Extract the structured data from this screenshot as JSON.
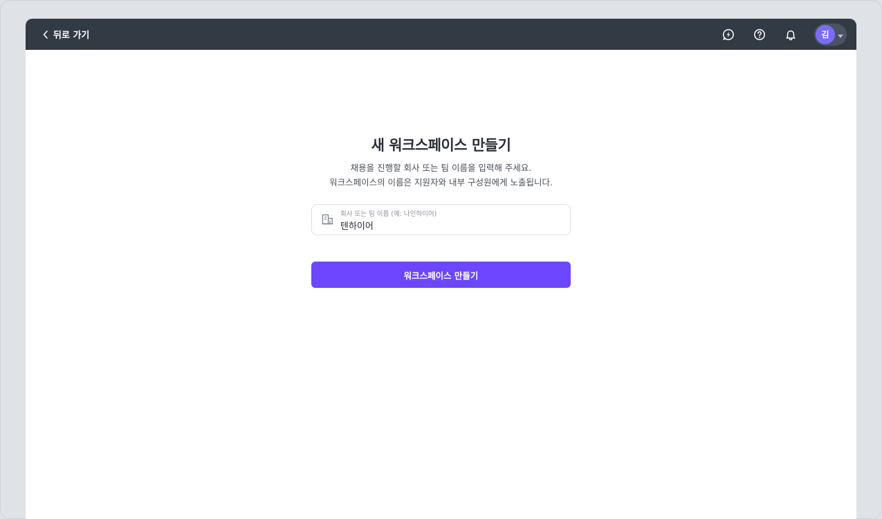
{
  "header": {
    "back_label": "뒤로 가기",
    "icons": [
      "chat-icon",
      "help-icon",
      "bell-icon"
    ],
    "avatar_initial": "김"
  },
  "main": {
    "title": "새 워크스페이스 만들기",
    "description_line1": "채용을 진행할 회사 또는 팀 이름을 입력해 주세요.",
    "description_line2": "워크스페이스의 이름은 지원자와 내부 구성원에게 노출됩니다.",
    "field": {
      "label": "회사 또는 팀 이름 (예: 나인하이어)",
      "value": "텐하이어"
    },
    "create_button_label": "워크스페이스 만들기"
  },
  "colors": {
    "topbar": "#323a44",
    "accent": "#6c47ff",
    "avatar": "#7a6cf7"
  }
}
